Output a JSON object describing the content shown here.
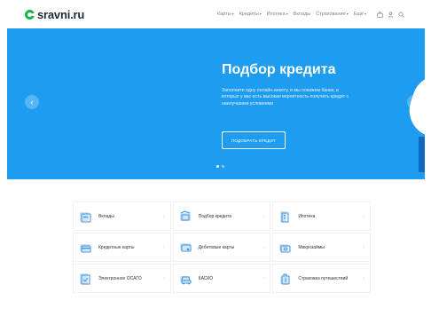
{
  "logo": {
    "text": "sravni.ru"
  },
  "nav": {
    "items": [
      {
        "label": "Карты",
        "caret": "▾"
      },
      {
        "label": "Кредиты",
        "caret": "▾"
      },
      {
        "label": "Ипотека",
        "caret": "▾"
      },
      {
        "label": "Вклады",
        "caret": ""
      },
      {
        "label": "Страхование",
        "caret": "▾"
      },
      {
        "label": "Ещё",
        "caret": "▾"
      }
    ],
    "icons": [
      "briefcase-icon",
      "user-icon",
      "search-icon"
    ]
  },
  "hero": {
    "title": "Подбор кредита",
    "text": "Заполните одну онлайн-анкету, и мы покажем банки, в которых у вас есть высокая вероятность получить кредит с наилучшими условиями",
    "button": "ПОДОБРАТЬ КРЕДИТ",
    "prev_arrow": "‹",
    "next_arrow": "›",
    "slides": 2,
    "active_slide": 1
  },
  "categories": [
    {
      "label": "Вклады",
      "icon": "deposit-icon"
    },
    {
      "label": "Подбор кредита",
      "icon": "credit-selection-icon"
    },
    {
      "label": "Ипотека",
      "icon": "mortgage-icon"
    },
    {
      "label": "Кредитные карты",
      "icon": "credit-card-icon"
    },
    {
      "label": "Дебетовые карты",
      "icon": "debit-card-icon"
    },
    {
      "label": "Микрозаймы",
      "icon": "microloan-icon"
    },
    {
      "label": "Электронное ОСАГО",
      "icon": "osago-icon"
    },
    {
      "label": "КАСКО",
      "icon": "kasko-icon"
    },
    {
      "label": "Страховка путешествий",
      "icon": "travel-insurance-icon"
    }
  ],
  "chevron": "›",
  "colors": {
    "brand_green": "#1bb24b",
    "hero_blue": "#1e9cef",
    "icon_blue": "#3a8fdc",
    "icon_light": "#cfe4f8"
  }
}
